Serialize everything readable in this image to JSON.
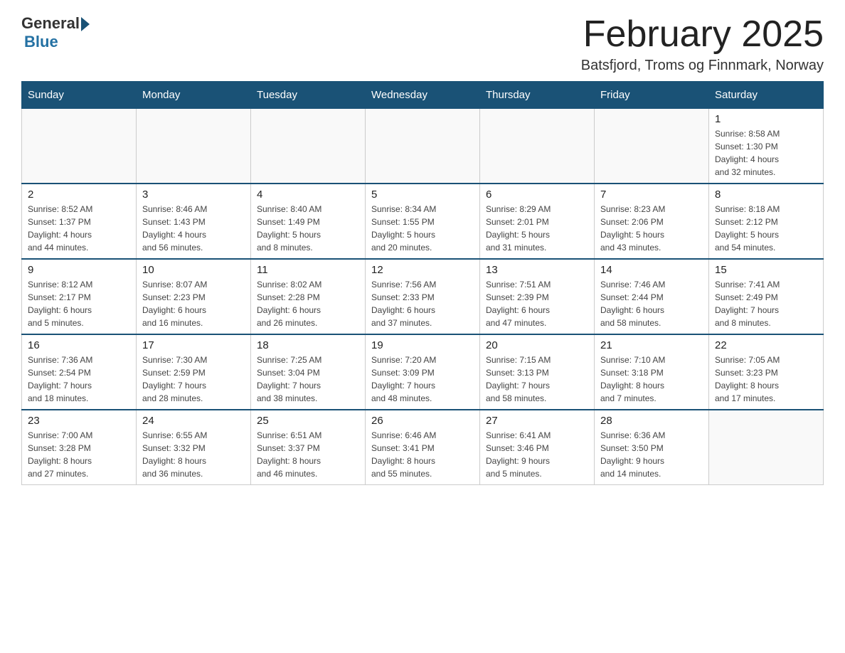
{
  "logo": {
    "general": "General",
    "blue": "Blue"
  },
  "title": "February 2025",
  "location": "Batsfjord, Troms og Finnmark, Norway",
  "headers": [
    "Sunday",
    "Monday",
    "Tuesday",
    "Wednesday",
    "Thursday",
    "Friday",
    "Saturday"
  ],
  "weeks": [
    [
      {
        "day": "",
        "info": ""
      },
      {
        "day": "",
        "info": ""
      },
      {
        "day": "",
        "info": ""
      },
      {
        "day": "",
        "info": ""
      },
      {
        "day": "",
        "info": ""
      },
      {
        "day": "",
        "info": ""
      },
      {
        "day": "1",
        "info": "Sunrise: 8:58 AM\nSunset: 1:30 PM\nDaylight: 4 hours\nand 32 minutes."
      }
    ],
    [
      {
        "day": "2",
        "info": "Sunrise: 8:52 AM\nSunset: 1:37 PM\nDaylight: 4 hours\nand 44 minutes."
      },
      {
        "day": "3",
        "info": "Sunrise: 8:46 AM\nSunset: 1:43 PM\nDaylight: 4 hours\nand 56 minutes."
      },
      {
        "day": "4",
        "info": "Sunrise: 8:40 AM\nSunset: 1:49 PM\nDaylight: 5 hours\nand 8 minutes."
      },
      {
        "day": "5",
        "info": "Sunrise: 8:34 AM\nSunset: 1:55 PM\nDaylight: 5 hours\nand 20 minutes."
      },
      {
        "day": "6",
        "info": "Sunrise: 8:29 AM\nSunset: 2:01 PM\nDaylight: 5 hours\nand 31 minutes."
      },
      {
        "day": "7",
        "info": "Sunrise: 8:23 AM\nSunset: 2:06 PM\nDaylight: 5 hours\nand 43 minutes."
      },
      {
        "day": "8",
        "info": "Sunrise: 8:18 AM\nSunset: 2:12 PM\nDaylight: 5 hours\nand 54 minutes."
      }
    ],
    [
      {
        "day": "9",
        "info": "Sunrise: 8:12 AM\nSunset: 2:17 PM\nDaylight: 6 hours\nand 5 minutes."
      },
      {
        "day": "10",
        "info": "Sunrise: 8:07 AM\nSunset: 2:23 PM\nDaylight: 6 hours\nand 16 minutes."
      },
      {
        "day": "11",
        "info": "Sunrise: 8:02 AM\nSunset: 2:28 PM\nDaylight: 6 hours\nand 26 minutes."
      },
      {
        "day": "12",
        "info": "Sunrise: 7:56 AM\nSunset: 2:33 PM\nDaylight: 6 hours\nand 37 minutes."
      },
      {
        "day": "13",
        "info": "Sunrise: 7:51 AM\nSunset: 2:39 PM\nDaylight: 6 hours\nand 47 minutes."
      },
      {
        "day": "14",
        "info": "Sunrise: 7:46 AM\nSunset: 2:44 PM\nDaylight: 6 hours\nand 58 minutes."
      },
      {
        "day": "15",
        "info": "Sunrise: 7:41 AM\nSunset: 2:49 PM\nDaylight: 7 hours\nand 8 minutes."
      }
    ],
    [
      {
        "day": "16",
        "info": "Sunrise: 7:36 AM\nSunset: 2:54 PM\nDaylight: 7 hours\nand 18 minutes."
      },
      {
        "day": "17",
        "info": "Sunrise: 7:30 AM\nSunset: 2:59 PM\nDaylight: 7 hours\nand 28 minutes."
      },
      {
        "day": "18",
        "info": "Sunrise: 7:25 AM\nSunset: 3:04 PM\nDaylight: 7 hours\nand 38 minutes."
      },
      {
        "day": "19",
        "info": "Sunrise: 7:20 AM\nSunset: 3:09 PM\nDaylight: 7 hours\nand 48 minutes."
      },
      {
        "day": "20",
        "info": "Sunrise: 7:15 AM\nSunset: 3:13 PM\nDaylight: 7 hours\nand 58 minutes."
      },
      {
        "day": "21",
        "info": "Sunrise: 7:10 AM\nSunset: 3:18 PM\nDaylight: 8 hours\nand 7 minutes."
      },
      {
        "day": "22",
        "info": "Sunrise: 7:05 AM\nSunset: 3:23 PM\nDaylight: 8 hours\nand 17 minutes."
      }
    ],
    [
      {
        "day": "23",
        "info": "Sunrise: 7:00 AM\nSunset: 3:28 PM\nDaylight: 8 hours\nand 27 minutes."
      },
      {
        "day": "24",
        "info": "Sunrise: 6:55 AM\nSunset: 3:32 PM\nDaylight: 8 hours\nand 36 minutes."
      },
      {
        "day": "25",
        "info": "Sunrise: 6:51 AM\nSunset: 3:37 PM\nDaylight: 8 hours\nand 46 minutes."
      },
      {
        "day": "26",
        "info": "Sunrise: 6:46 AM\nSunset: 3:41 PM\nDaylight: 8 hours\nand 55 minutes."
      },
      {
        "day": "27",
        "info": "Sunrise: 6:41 AM\nSunset: 3:46 PM\nDaylight: 9 hours\nand 5 minutes."
      },
      {
        "day": "28",
        "info": "Sunrise: 6:36 AM\nSunset: 3:50 PM\nDaylight: 9 hours\nand 14 minutes."
      },
      {
        "day": "",
        "info": ""
      }
    ]
  ]
}
